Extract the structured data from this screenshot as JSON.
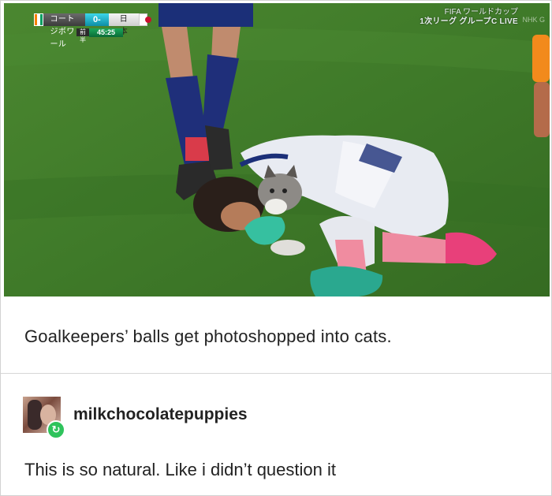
{
  "tv_overlay": {
    "team_home": "コートジボワール",
    "score": "0-1",
    "team_away": "日本",
    "half_label": "前半",
    "clock": "45:25",
    "broadcast_line1": "FIFA ワールドカップ",
    "broadcast_line2": "1次リーグ グループC LIVE",
    "watermark": "NHK G"
  },
  "post": {
    "caption": "Goalkeepers’ balls get photoshopped into cats.",
    "reblog": {
      "username": "milkchocolatepuppies",
      "comment": "This is so natural. Like i didn’t question it",
      "badge_icon": "↻"
    }
  },
  "colors": {
    "pitch": "#3f7a2a",
    "reblog_badge": "#2fc35c",
    "kit_blue": "#1b2f78",
    "boot_pink": "#e8407a"
  }
}
